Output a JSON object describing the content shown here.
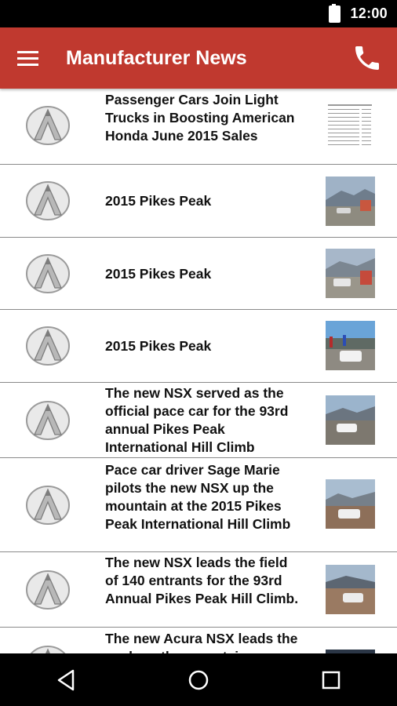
{
  "status": {
    "time": "12:00"
  },
  "appbar": {
    "title": "Manufacturer News",
    "menu_icon": "hamburger-menu-icon",
    "call_icon": "phone-icon"
  },
  "articles": [
    {
      "title": "Passenger Cars Join Light Trucks in Boosting American Honda June 2015 Sales",
      "thumb": "sales-table-thumbnail"
    },
    {
      "title": "2015 Pikes Peak",
      "thumb": "race-car-photo"
    },
    {
      "title": "2015 Pikes Peak",
      "thumb": "race-car-photo"
    },
    {
      "title": "2015 Pikes Peak",
      "thumb": "pace-car-crowd-photo"
    },
    {
      "title": "The new NSX served as the official pace car for the 93rd annual Pikes Peak International Hill Climb",
      "thumb": "nsx-on-road-photo"
    },
    {
      "title": "Pace car driver Sage Marie pilots the new NSX up the mountain at the 2015 Pikes Peak International Hill Climb",
      "thumb": "nsx-mountain-photo"
    },
    {
      "title": "The new NSX leads the field of 140 entrants for the 93rd Annual Pikes Peak Hill Climb.",
      "thumb": "nsx-lead-photo"
    },
    {
      "title": "The new Acura NSX leads the pack up the mountain",
      "thumb": "nsx-photo"
    }
  ],
  "navbar": {
    "back": "back-icon",
    "home": "home-icon",
    "recents": "recents-icon"
  }
}
